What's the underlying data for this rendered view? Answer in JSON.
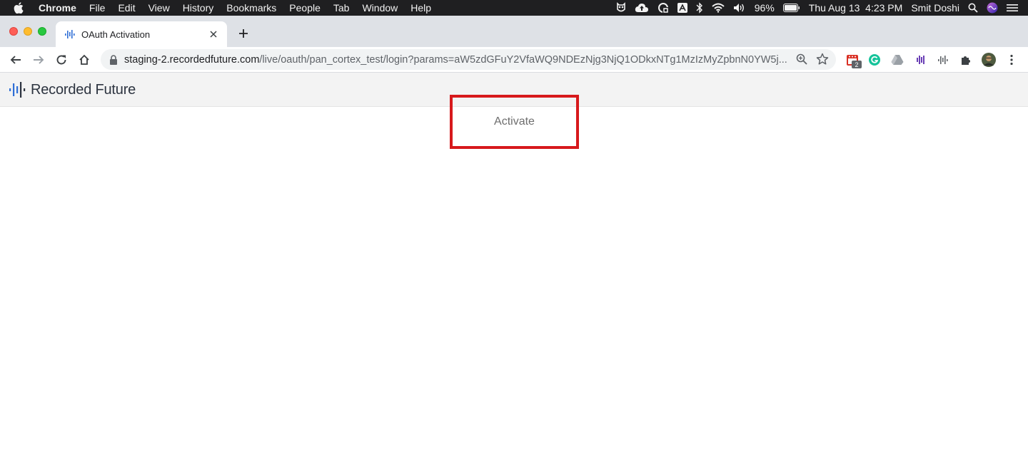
{
  "menubar": {
    "app_name": "Chrome",
    "menus": [
      "File",
      "Edit",
      "View",
      "History",
      "Bookmarks",
      "People",
      "Tab",
      "Window",
      "Help"
    ],
    "battery": "96%",
    "datetime": "Thu Aug 13  4:23 PM",
    "user": "Smit Doshi"
  },
  "tab": {
    "title": "OAuth Activation"
  },
  "address_bar": {
    "host": "staging-2.recordedfuture.com",
    "path": "/live/oauth/pan_cortex_test/login?params=aW5zdGFuY2VfaWQ9NDEzNjg3NjQ1ODkxNTg1MzIzMyZpbnN0YW5j..."
  },
  "extensions": {
    "badge_count": "2"
  },
  "page": {
    "logo_text": "Recorded Future",
    "activate_label": "Activate"
  },
  "colors": {
    "highlight_box": "#d7191c",
    "header_bg": "#f3f3f3",
    "logo_blue": "#2f6fd6"
  }
}
